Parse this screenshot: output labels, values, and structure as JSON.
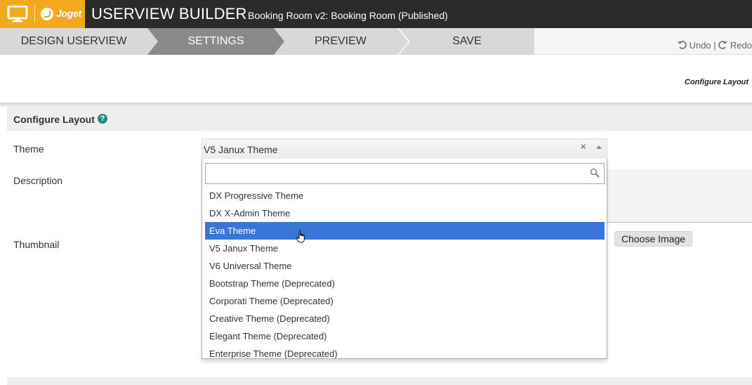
{
  "header": {
    "brand": "Joget",
    "builder_title": "USERVIEW BUILDER",
    "app_subtitle": "Booking Room v2: Booking Room (Published)"
  },
  "steps": [
    {
      "label": "DESIGN USERVIEW",
      "active": false
    },
    {
      "label": "SETTINGS",
      "active": true
    },
    {
      "label": "PREVIEW",
      "active": false
    },
    {
      "label": "SAVE",
      "active": false
    }
  ],
  "toolbar": {
    "undo_label": "Undo",
    "separator": "|",
    "redo_label": "Redo"
  },
  "canvas": {
    "configure_link": "Configure Layout"
  },
  "form": {
    "section_title": "Configure Layout",
    "help_symbol": "?",
    "labels": {
      "theme": "Theme",
      "description": "Description",
      "thumbnail": "Thumbnail"
    },
    "theme_value": "V5 Janux Theme",
    "clear_symbol": "×",
    "choose_image_label": "Choose Image"
  },
  "dropdown": {
    "search_value": "",
    "options": [
      {
        "label": "DX Progressive Theme",
        "selected": false
      },
      {
        "label": "DX X-Admin Theme",
        "selected": false
      },
      {
        "label": "Eva Theme",
        "selected": true
      },
      {
        "label": "V5 Janux Theme",
        "selected": false
      },
      {
        "label": "V6 Universal Theme",
        "selected": false
      },
      {
        "label": "Bootstrap Theme (Deprecated)",
        "selected": false
      },
      {
        "label": "Corporati Theme (Deprecated)",
        "selected": false
      },
      {
        "label": "Creative Theme (Deprecated)",
        "selected": false
      },
      {
        "label": "Elegant Theme (Deprecated)",
        "selected": false
      },
      {
        "label": "Enterprise Theme (Deprecated)",
        "selected": false
      }
    ]
  },
  "colors": {
    "brand": "#f3a81e",
    "header_bg": "#2b2b2b",
    "selected_option": "#3875d7",
    "help_icon": "#1e8f7f"
  }
}
